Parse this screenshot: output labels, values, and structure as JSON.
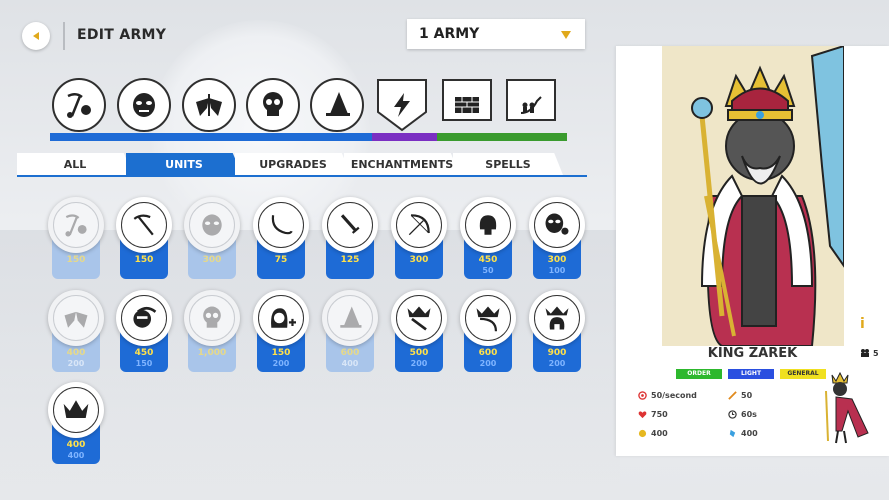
{
  "header": {
    "title": "EDIT ARMY",
    "army_select": "1 ARMY"
  },
  "categories": [
    {
      "icon": "miner-icon",
      "type": "circle"
    },
    {
      "icon": "mask-icon",
      "type": "circle"
    },
    {
      "icon": "wings-icon",
      "type": "circle"
    },
    {
      "icon": "skull-icon",
      "type": "circle"
    },
    {
      "icon": "wizard-hat-icon",
      "type": "circle"
    },
    {
      "icon": "lightning-icon",
      "type": "shield"
    },
    {
      "icon": "wall-icon",
      "type": "shield"
    },
    {
      "icon": "tactics-icon",
      "type": "shield"
    }
  ],
  "category_bar_colors": {
    "units": "#1e6bd6",
    "enchantments": "#7b2fc2",
    "upgrades": "#3a9b2e"
  },
  "tabs": [
    "ALL",
    "UNITS",
    "UPGRADES",
    "ENCHANTMENTS",
    "SPELLS"
  ],
  "active_tab": "UNITS",
  "units_row1": [
    {
      "icon": "miner-icon",
      "price": "150",
      "pop": "",
      "locked": true
    },
    {
      "icon": "pickaxe-icon",
      "price": "150",
      "pop": "",
      "locked": false
    },
    {
      "icon": "mask-icon",
      "price": "300",
      "pop": "",
      "locked": true
    },
    {
      "icon": "whip-icon",
      "price": "75",
      "pop": "",
      "locked": false
    },
    {
      "icon": "sword-icon",
      "price": "125",
      "pop": "",
      "locked": false
    },
    {
      "icon": "bow-icon",
      "price": "300",
      "pop": "",
      "locked": false
    },
    {
      "icon": "spartan-helmet-icon",
      "price": "450",
      "pop": "50",
      "locked": false
    },
    {
      "icon": "mask-skull-icon",
      "price": "300",
      "pop": "100",
      "locked": false
    }
  ],
  "units_row2": [
    {
      "icon": "wings-icon",
      "price": "400",
      "pop": "200",
      "locked": true
    },
    {
      "icon": "ninja-icon",
      "price": "450",
      "pop": "150",
      "locked": false
    },
    {
      "icon": "skull-icon",
      "price": "1,000",
      "pop": "",
      "locked": true
    },
    {
      "icon": "hooded-plus-icon",
      "price": "150",
      "pop": "200",
      "locked": false
    },
    {
      "icon": "wizard-hat-icon",
      "price": "600",
      "pop": "400",
      "locked": true
    },
    {
      "icon": "crown-sword-icon",
      "price": "500",
      "pop": "200",
      "locked": false
    },
    {
      "icon": "crown-bow-icon",
      "price": "600",
      "pop": "200",
      "locked": false
    },
    {
      "icon": "crown-helmet-icon",
      "price": "900",
      "pop": "200",
      "locked": false
    }
  ],
  "units_row3": [
    {
      "icon": "crown-icon",
      "price": "400",
      "pop": "400",
      "locked": false
    }
  ],
  "detail": {
    "name": "KING ZAREK",
    "tags": [
      {
        "label": "ORDER",
        "color": "#2db82d"
      },
      {
        "label": "LIGHT",
        "color": "#2a4fe0"
      },
      {
        "label": "GENERAL",
        "color": "#f0e020"
      }
    ],
    "pop_count": "5",
    "stats": {
      "rate": "50/second",
      "health": "750",
      "gold": "400",
      "damage": "50",
      "time": "60s",
      "mana": "400"
    }
  }
}
